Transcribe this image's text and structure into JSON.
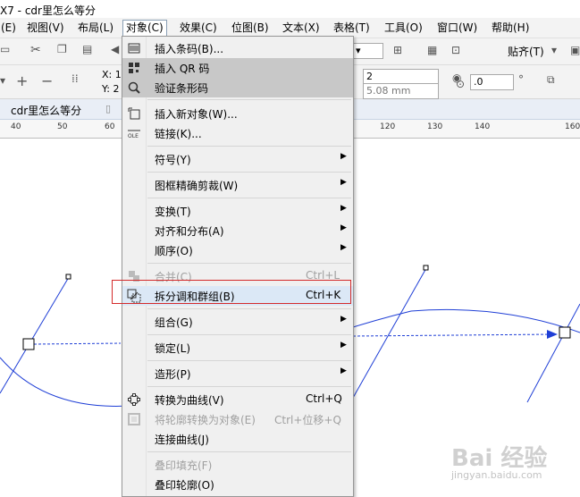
{
  "window": {
    "title": "X7 - cdr里怎么等分"
  },
  "menubar": {
    "items": [
      "(E)",
      "视图(V)",
      "布局(L)",
      "对象(C)",
      "效果(C)",
      "位图(B)",
      "文本(X)",
      "表格(T)",
      "工具(O)",
      "窗口(W)",
      "帮助(H)"
    ]
  },
  "toolbar": {
    "snap_label": "贴齐(T)",
    "x_label": "X: 1",
    "y_label": "Y: 2",
    "steps_value": "2",
    "spacing_value": "5.08 mm",
    "angle_value": ".0"
  },
  "doc_tab": {
    "label": "cdr里怎么等分"
  },
  "ruler": {
    "ticks": [
      "40",
      "50",
      "60",
      "120",
      "130",
      "140",
      "160"
    ]
  },
  "context_menu": {
    "items": [
      {
        "label": "插入条码(B)...",
        "shortcut": "",
        "submenu": false,
        "disabled": false,
        "icon": "barcode-icon"
      },
      {
        "label": "插入 QR 码",
        "shortcut": "",
        "submenu": false,
        "disabled": false,
        "icon": "qr-code-icon"
      },
      {
        "label": "验证条形码",
        "shortcut": "",
        "submenu": false,
        "disabled": false,
        "icon": "magnifier-icon"
      },
      {
        "label": "插入新对象(W)...",
        "shortcut": "",
        "submenu": false,
        "disabled": false,
        "icon": "insert-object-icon"
      },
      {
        "label": "链接(K)...",
        "shortcut": "",
        "submenu": false,
        "disabled": false,
        "icon": "ole-link-icon"
      },
      {
        "label": "符号(Y)",
        "shortcut": "",
        "submenu": true,
        "disabled": false,
        "icon": ""
      },
      {
        "label": "图框精确剪裁(W)",
        "shortcut": "",
        "submenu": true,
        "disabled": false,
        "icon": ""
      },
      {
        "label": "变换(T)",
        "shortcut": "",
        "submenu": true,
        "disabled": false,
        "icon": ""
      },
      {
        "label": "对齐和分布(A)",
        "shortcut": "",
        "submenu": true,
        "disabled": false,
        "icon": ""
      },
      {
        "label": "顺序(O)",
        "shortcut": "",
        "submenu": true,
        "disabled": false,
        "icon": ""
      },
      {
        "label": "合并(C)",
        "shortcut": "Ctrl+L",
        "submenu": false,
        "disabled": true,
        "icon": "combine-icon"
      },
      {
        "label": "拆分调和群组(B)",
        "shortcut": "Ctrl+K",
        "submenu": false,
        "disabled": false,
        "icon": "break-apart-icon"
      },
      {
        "label": "组合(G)",
        "shortcut": "",
        "submenu": true,
        "disabled": false,
        "icon": ""
      },
      {
        "label": "锁定(L)",
        "shortcut": "",
        "submenu": true,
        "disabled": false,
        "icon": ""
      },
      {
        "label": "造形(P)",
        "shortcut": "",
        "submenu": true,
        "disabled": false,
        "icon": ""
      },
      {
        "label": "转换为曲线(V)",
        "shortcut": "Ctrl+Q",
        "submenu": false,
        "disabled": false,
        "icon": "convert-curves-icon"
      },
      {
        "label": "将轮廓转换为对象(E)",
        "shortcut": "Ctrl+位移+Q",
        "submenu": false,
        "disabled": true,
        "icon": "outline-object-icon"
      },
      {
        "label": "连接曲线(J)",
        "shortcut": "",
        "submenu": false,
        "disabled": false,
        "icon": ""
      },
      {
        "label": "叠印填充(F)",
        "shortcut": "",
        "submenu": false,
        "disabled": true,
        "icon": ""
      },
      {
        "label": "叠印轮廓(O)",
        "shortcut": "",
        "submenu": false,
        "disabled": false,
        "icon": ""
      }
    ]
  },
  "watermark": {
    "brand": "Bai 经验",
    "url": "jingyan.baidu.com"
  },
  "colors": {
    "menu_highlight": "#dbe8f6",
    "annotation_red": "#d42a2a",
    "curve_blue": "#1f3fd6"
  }
}
